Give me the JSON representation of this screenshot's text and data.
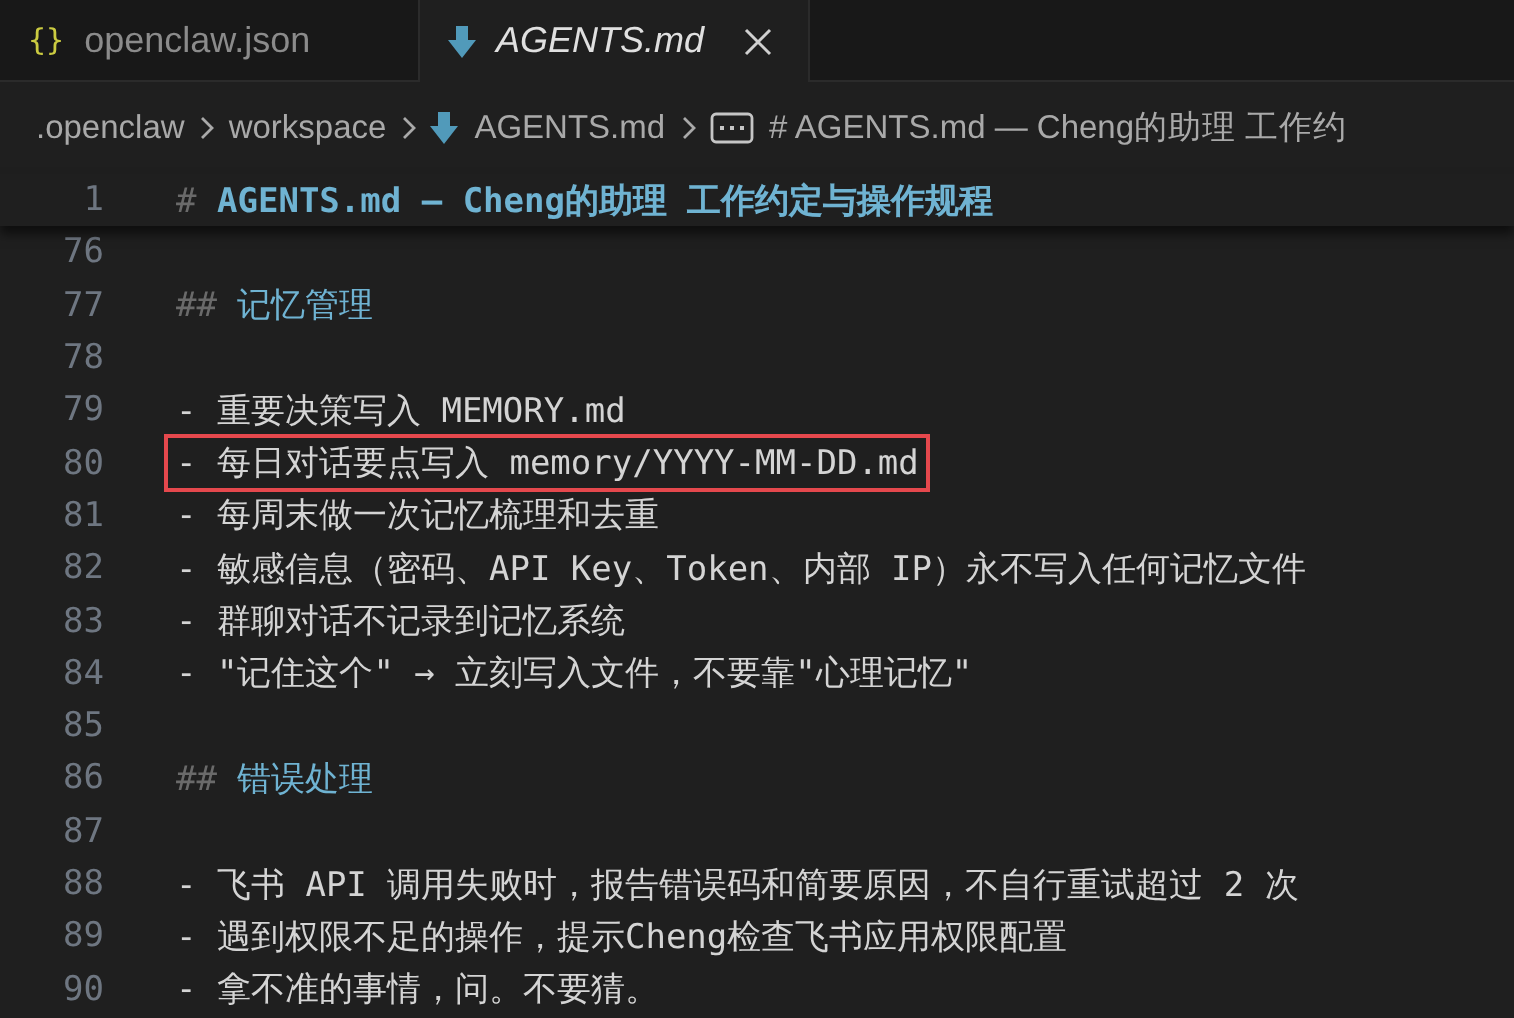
{
  "tabs": [
    {
      "label": "openclaw.json",
      "kind": "json",
      "icon": "{}",
      "selected": false,
      "preview": false
    },
    {
      "label": "AGENTS.md",
      "kind": "markdown",
      "selected": true,
      "preview": true
    }
  ],
  "breadcrumb": [
    {
      "label": ".openclaw",
      "kind": "folder"
    },
    {
      "label": "workspace",
      "kind": "folder"
    },
    {
      "label": "AGENTS.md",
      "kind": "markdown"
    },
    {
      "label": "# AGENTS.md — Cheng的助理 工作约",
      "kind": "symbol"
    }
  ],
  "sticky_line": {
    "number": "1",
    "marker": "#",
    "text": "AGENTS.md — Cheng的助理 工作约定与操作规程"
  },
  "lines": [
    {
      "number": "76",
      "kind": "blank",
      "highlighted": false
    },
    {
      "number": "77",
      "kind": "heading",
      "marker": "##",
      "text": "记忆管理",
      "highlighted": false
    },
    {
      "number": "78",
      "kind": "blank",
      "highlighted": false
    },
    {
      "number": "79",
      "kind": "text",
      "text": "- 重要决策写入 MEMORY.md",
      "highlighted": false
    },
    {
      "number": "80",
      "kind": "text",
      "text": "- 每日对话要点写入 memory/YYYY-MM-DD.md",
      "highlighted": true
    },
    {
      "number": "81",
      "kind": "text",
      "text": "- 每周末做一次记忆梳理和去重",
      "highlighted": false
    },
    {
      "number": "82",
      "kind": "text",
      "text": "- 敏感信息（密码、API Key、Token、内部 IP）永不写入任何记忆文件",
      "highlighted": false
    },
    {
      "number": "83",
      "kind": "text",
      "text": "- 群聊对话不记录到记忆系统",
      "highlighted": false
    },
    {
      "number": "84",
      "kind": "text",
      "text": "- \"记住这个\" → 立刻写入文件，不要靠\"心理记忆\"",
      "highlighted": false
    },
    {
      "number": "85",
      "kind": "blank",
      "highlighted": false
    },
    {
      "number": "86",
      "kind": "heading",
      "marker": "##",
      "text": "错误处理",
      "highlighted": false
    },
    {
      "number": "87",
      "kind": "blank",
      "highlighted": false
    },
    {
      "number": "88",
      "kind": "text",
      "text": "- 飞书 API 调用失败时，报告错误码和简要原因，不自行重试超过 2 次",
      "highlighted": false
    },
    {
      "number": "89",
      "kind": "text",
      "text": "- 遇到权限不足的操作，提示Cheng检查飞书应用权限配置",
      "highlighted": false
    },
    {
      "number": "90",
      "kind": "text",
      "text": "- 拿不准的事情，问。不要猜。",
      "highlighted": false
    }
  ]
}
